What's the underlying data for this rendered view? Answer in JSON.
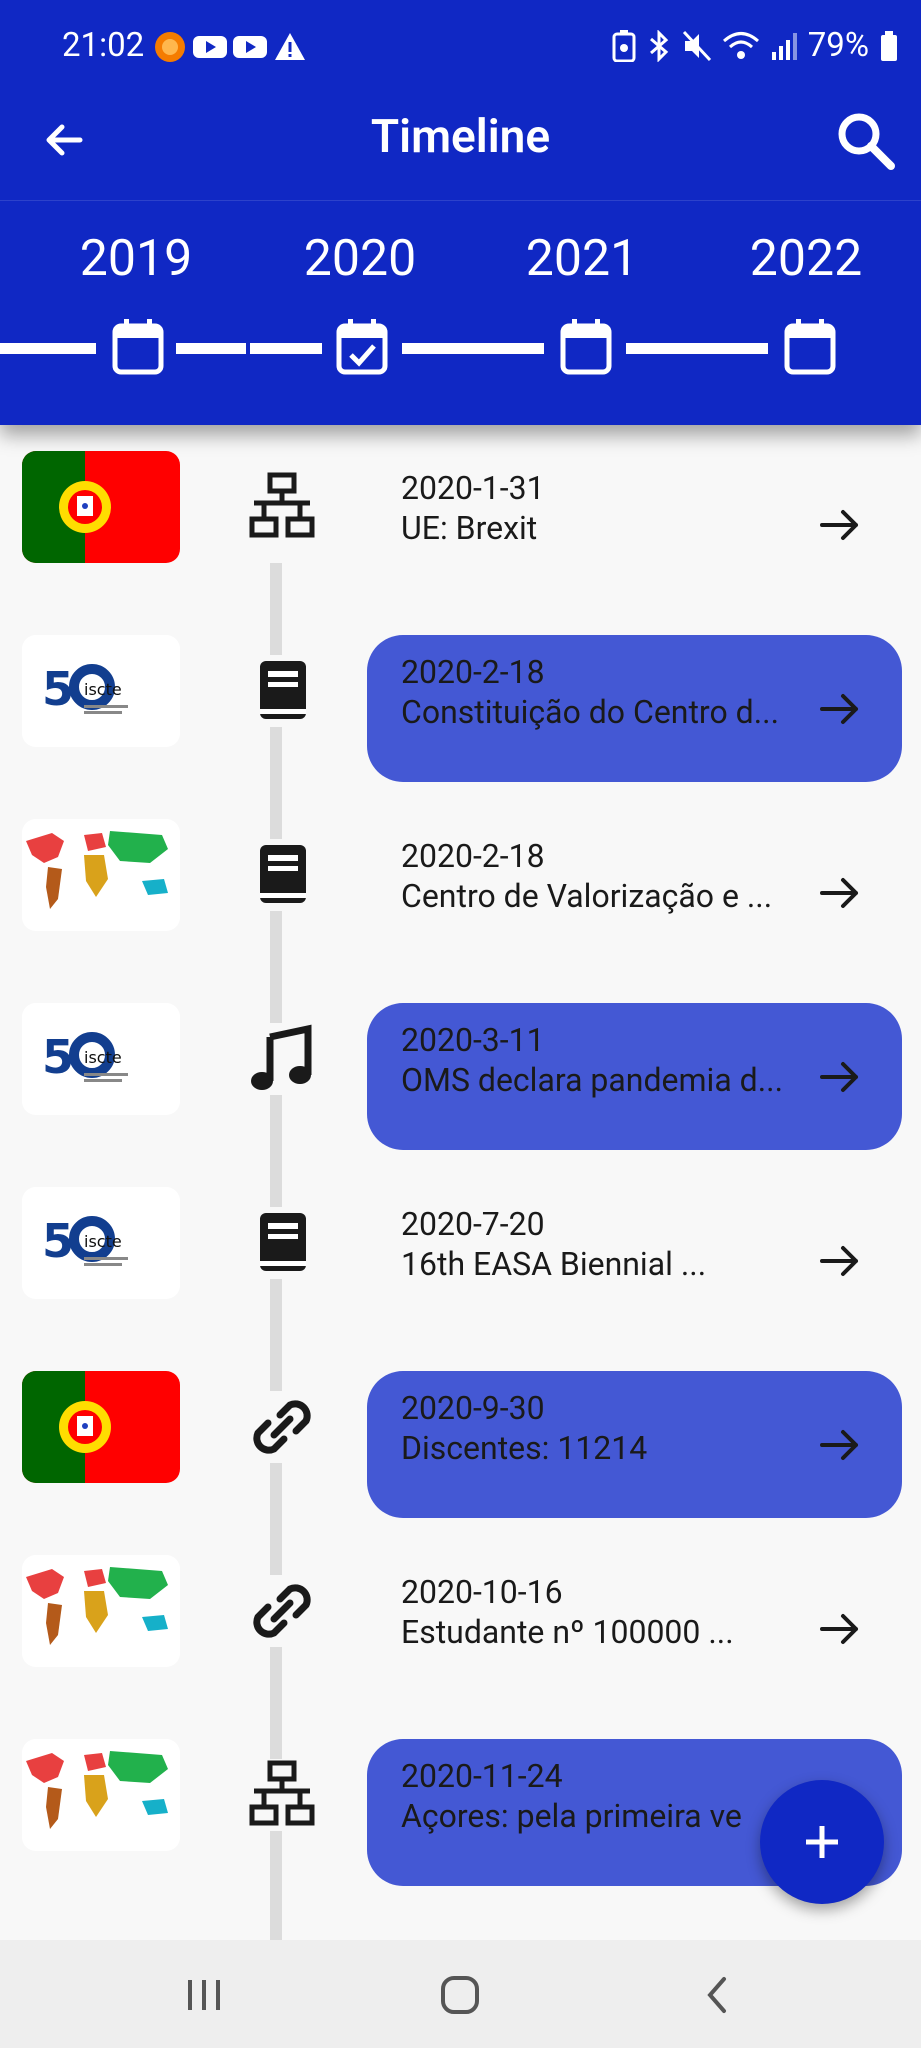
{
  "status_bar": {
    "time": "21:02",
    "battery": "79%",
    "notification_icons": [
      "app-icon",
      "youtube-icon",
      "youtube-icon",
      "warning-icon"
    ],
    "system_icons": [
      "battery-saver-icon",
      "bluetooth-icon",
      "mute-icon",
      "wifi-icon",
      "signal-icon",
      "battery-icon"
    ]
  },
  "app_bar": {
    "title": "Timeline",
    "back_icon": "arrow-back-icon",
    "search_icon": "search-icon"
  },
  "year_selector": {
    "years": [
      "2019",
      "2020",
      "2021",
      "2022"
    ],
    "selected": "2020"
  },
  "timeline": {
    "items": [
      {
        "date": "2020-1-31",
        "title": "UE: Brexit",
        "thumbnail": "portugal-flag",
        "type_icon": "network-icon",
        "highlighted": false
      },
      {
        "date": "2020-2-18",
        "title": "Constituição do Centro d...",
        "thumbnail": "iscte-50-logo",
        "type_icon": "book-icon",
        "highlighted": true
      },
      {
        "date": "2020-2-18",
        "title": "Centro de Valorização e ...",
        "thumbnail": "world-map",
        "type_icon": "book-icon",
        "highlighted": false
      },
      {
        "date": "2020-3-11",
        "title": "OMS declara pandemia d...",
        "thumbnail": "iscte-50-logo",
        "type_icon": "music-icon",
        "highlighted": true
      },
      {
        "date": "2020-7-20",
        "title": "16th EASA Biennial ...",
        "thumbnail": "iscte-50-logo",
        "type_icon": "book-icon",
        "highlighted": false
      },
      {
        "date": "2020-9-30",
        "title": "Discentes: 11214",
        "thumbnail": "portugal-flag",
        "type_icon": "link-icon",
        "highlighted": true
      },
      {
        "date": "2020-10-16",
        "title": "Estudante nº 100000 ...",
        "thumbnail": "world-map",
        "type_icon": "link-icon",
        "highlighted": false
      },
      {
        "date": "2020-11-24",
        "title": "Açores: pela primeira ve",
        "thumbnail": "world-map",
        "type_icon": "network-icon",
        "highlighted": true
      }
    ]
  },
  "fab": {
    "label": "+"
  },
  "colors": {
    "primary": "#1028c4",
    "highlight_card": "#4458d4",
    "background": "#f8f8f8"
  }
}
